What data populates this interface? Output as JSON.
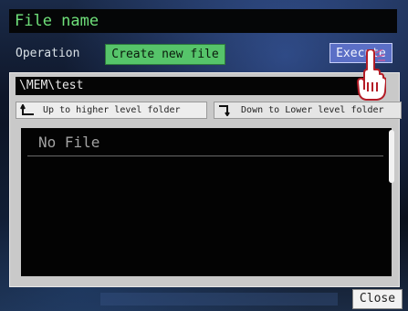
{
  "window": {
    "title": "File name"
  },
  "operation": {
    "label": "Operation",
    "value": "Create new file"
  },
  "execute_button": {
    "label": "Execute"
  },
  "path": {
    "current": "\\MEM\\test"
  },
  "nav": {
    "up_label": "Up to higher level folder",
    "down_label": "Down to Lower level folder"
  },
  "file_list": {
    "empty_text": "No File"
  },
  "close_button": {
    "label": "Close"
  },
  "icons": {
    "up": "arrow-up-left-icon",
    "down": "arrow-down-right-icon",
    "pointer": "pointing-hand-icon"
  },
  "colors": {
    "title_text": "#6fe07a",
    "operation_bg": "#56c46a",
    "execute_bg": "#5b6fc6"
  }
}
